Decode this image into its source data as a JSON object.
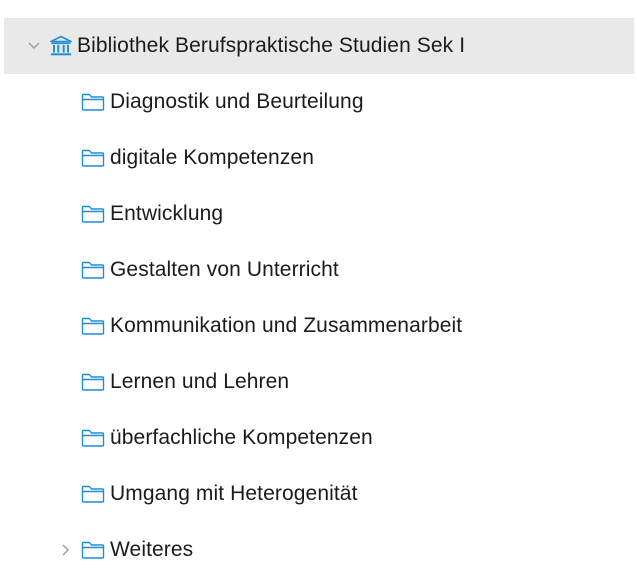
{
  "root": {
    "label": "Bibliothek Berufspraktische Studien Sek I",
    "icon": "library-icon",
    "expanded": true
  },
  "items": [
    {
      "label": "Diagnostik und Beurteilung",
      "icon": "folder-icon"
    },
    {
      "label": "digitale Kompetenzen",
      "icon": "folder-icon"
    },
    {
      "label": "Entwicklung",
      "icon": "folder-icon"
    },
    {
      "label": "Gestalten von Unterricht",
      "icon": "folder-icon"
    },
    {
      "label": "Kommunikation und Zusammenarbeit",
      "icon": "folder-icon"
    },
    {
      "label": "Lernen und Lehren",
      "icon": "folder-icon"
    },
    {
      "label": "überfachliche Kompetenzen",
      "icon": "folder-icon"
    },
    {
      "label": "Umgang mit Heterogenität",
      "icon": "folder-icon"
    },
    {
      "label": "Weiteres",
      "icon": "folder-icon",
      "collapsed": true
    }
  ],
  "colors": {
    "accent": "#1e8ed6",
    "selected_row": "#e9e9e9",
    "chevron": "#9a9a9a"
  }
}
